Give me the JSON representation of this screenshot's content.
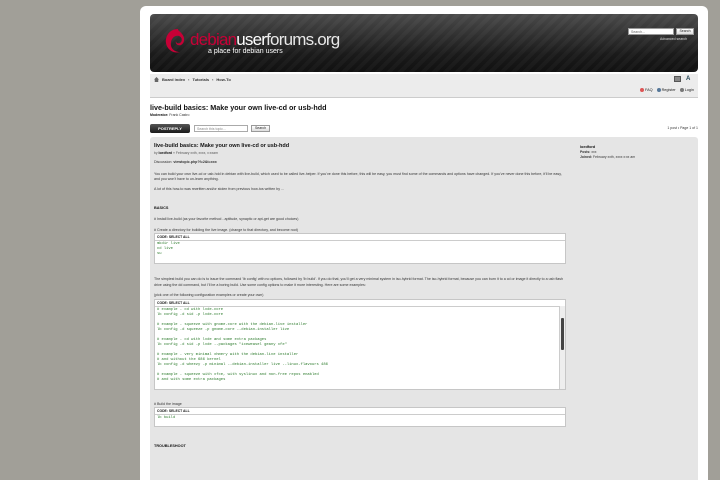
{
  "header": {
    "logo_part1": "debian",
    "logo_part2": "user",
    "logo_part3": "forums.org",
    "tagline": "a place for debian users",
    "search_placeholder": "Search...",
    "search_button": "Search",
    "advanced_search": "Advanced search"
  },
  "nav": {
    "breadcrumb": [
      "Board index",
      "Tutorials",
      "How-To"
    ],
    "faq": "FAQ",
    "register": "Register",
    "login": "Login"
  },
  "topic": {
    "title": "live-build basics: Make your own live-cd or usb-hdd",
    "moderator_label": "Moderator:",
    "moderator": "Frank Castro",
    "reply_button": "POSTREPLY",
    "search_placeholder": "Search this topic...",
    "search_button": "Search",
    "pagination": "1 post • Page 1 of 1"
  },
  "post": {
    "title": "live-build basics: Make your own live-cd or usb-hdd",
    "meta_by": "by",
    "author": "loedford",
    "date": " » February xxth, xxxx, x:xxam",
    "discussion_label": "Discussion: ",
    "discussion_link": "viewtopic.php?f=2&t=xxx",
    "para1": "You can build your own live-cd or usb-hdd in debian with live-build, which used to be called live-helper. If you've done this before, this will be easy, you must find some of the commands and options have changed. If you've never done this before, it'll be easy, and you won't have to un-learn anything.",
    "para2": "A lot of this how-to was rewritten and/or stolen from previous how-tos written by ...",
    "basics_heading": "BASICS",
    "step1": "# Install live-build (as your favorite method - aptitude, synaptic or apt-get are good choices)",
    "step2": "# Create a directory for building the live image. (change to that directory, and become root)",
    "code_label": "CODE: SELECT ALL",
    "code1": [
      "mkdir live",
      "cd live",
      "su"
    ],
    "para3": "The simplest build you can do is to issue the command 'lb config' with no options, followed by 'lb build'. If you do that, you'll get a very minimal system in iso-hybrid format. The iso-hybrid format, because you can burn it to a cd or image it directly to a usb flash drive using the dd command, but I'll be a boring build. Use some config options to make it more interesting. Here are some examples:",
    "para4": "(pick one of the following configuration examples or create your own)",
    "code2": [
      "# example - cd with lxde-core",
      "lb config -d sid -p lxde-core",
      "",
      "# example - squeeze with gnome-core with the debian-live installer",
      "lb config -d squeeze -p gnome-core --debian-installer live",
      "",
      "# example - cd with lxde and some extra packages",
      "lb config -d sid -p lxde --packages \"iceweasel geany xfe\"",
      "",
      "# example - very minimal xhmery with the debian-live installer",
      "# and without the 686 kernel",
      "lb config -d wheezy -p minimal --debian-installer live --linux-flavours 486",
      "",
      "# example - squeeze with xfce, with syslinux and non-free repos enabled",
      "# and with some extra packages"
    ],
    "step3": "# Build the image",
    "code3": [
      "lb build"
    ],
    "troubleshoot_heading": "TROUBLESHOOT"
  },
  "profile": {
    "username": "loedford",
    "posts_label": "Posts:",
    "posts": "xxx",
    "joined_label": "Joined:",
    "joined": "February xxth, xxxx x:xx am"
  },
  "colors": {
    "accent": "#c70036",
    "background": "#a19f98",
    "post_bg": "#e5e5e5"
  }
}
